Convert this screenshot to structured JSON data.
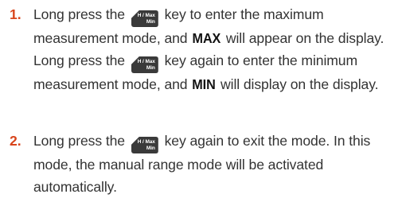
{
  "key_icon": {
    "line1": "H / Max",
    "line2": "Min"
  },
  "steps": [
    {
      "number": "1.",
      "t1": "Long press the",
      "t2": "key to enter the maximum measurement mode, and",
      "badge1": "MAX",
      "t3": "will appear on the display. Long press the",
      "t4": "key again to enter the minimum measurement mode, and",
      "badge2": "MIN",
      "t5": "will display on the display."
    },
    {
      "number": "2.",
      "t1": "Long press the",
      "t2": "key again to exit the mode. In this mode, the manual range mode will be activated automatically."
    }
  ]
}
